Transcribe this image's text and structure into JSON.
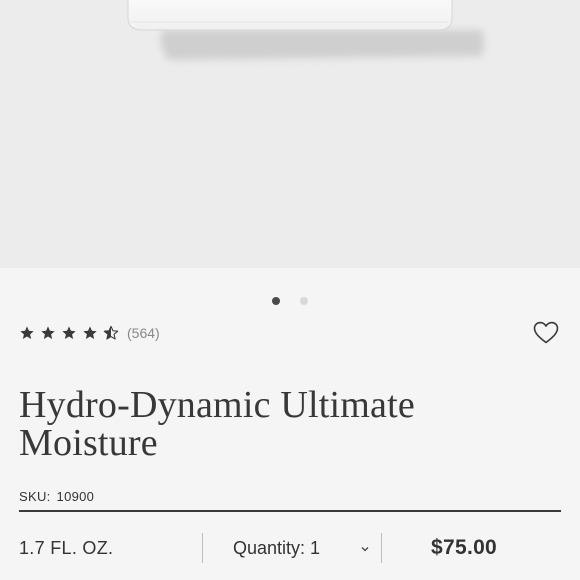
{
  "product": {
    "image": {
      "dots": [
        {
          "active": true
        },
        {
          "active": false
        }
      ]
    },
    "rating": {
      "stars": 4.5,
      "max": 5,
      "count": "(564)"
    },
    "title": "Hydro-Dynamic Ultimate Moisture",
    "sku": {
      "label": "SKU:",
      "value": "10900"
    },
    "size": "1.7 FL. OZ.",
    "quantity": {
      "label": "Quantity: 1"
    },
    "price": "$75.00"
  },
  "colors": {
    "hero_bg": "#ececec",
    "page_bg": "#f5f5f5",
    "text": "#333333",
    "dot_active": "#4a4a4a",
    "dot_inactive": "#d8d8d8"
  },
  "icons": {
    "star": "star-icon",
    "half_star": "half-star-icon",
    "wishlist": "heart-outline-icon",
    "dropdown": "chevron-down-icon"
  }
}
